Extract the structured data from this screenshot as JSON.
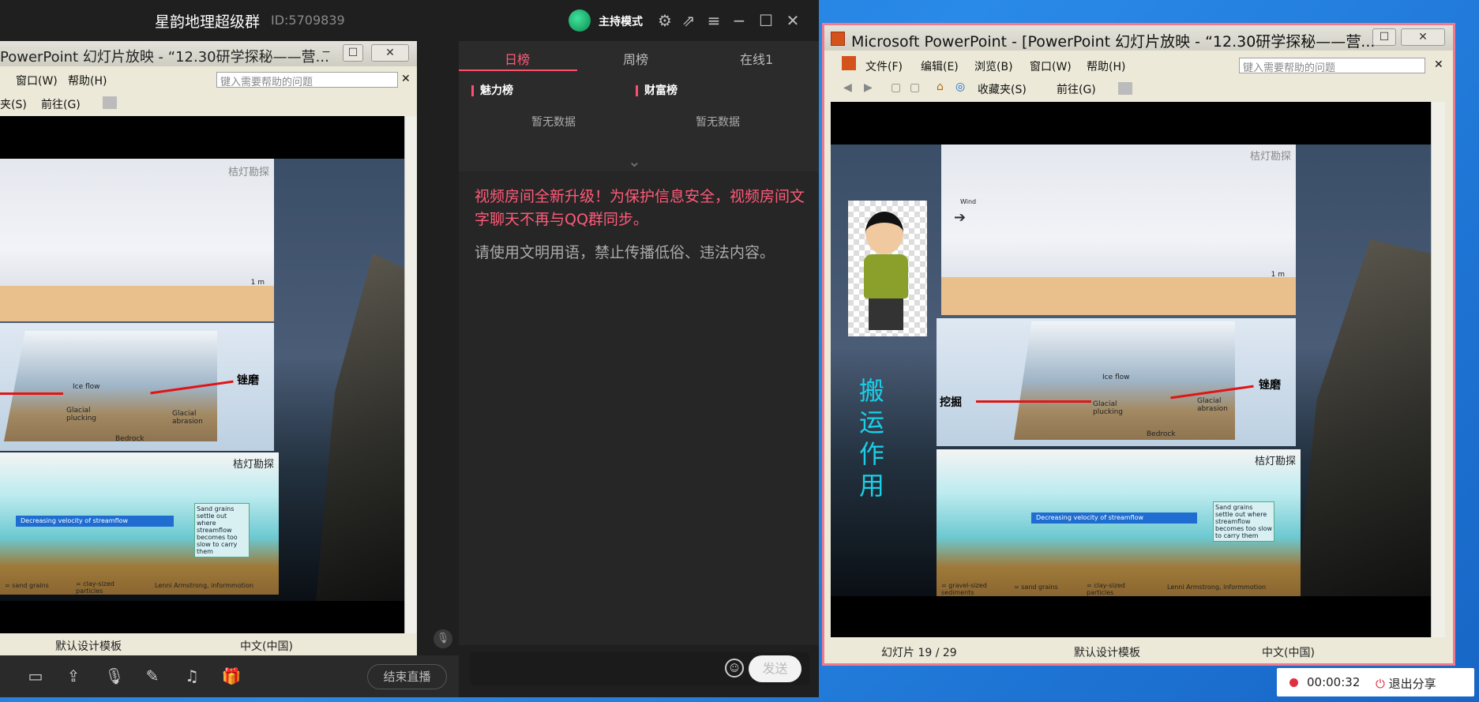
{
  "qq": {
    "group_name": "星韵地理超级群",
    "group_id": "ID:5709839",
    "host_mode": "主持模式",
    "tabs": [
      "日榜",
      "周榜",
      "在线1"
    ],
    "charm_rank": "魅力榜",
    "wealth_rank": "财富榜",
    "no_data": "暂无数据",
    "notice": "视频房间全新升级！为保护信息安全，视频房间文字聊天不再与QQ群同步。",
    "rules": "请使用文明用语，禁止传播低俗、违法内容。",
    "send": "发送",
    "end_live": "结束直播"
  },
  "left_ppt": {
    "title": "PowerPoint 幻灯片放映 - “12.30研学探秘——营...",
    "menu": [
      "窗口(W)",
      "帮助(H)"
    ],
    "help_placeholder": "键入需要帮助的问题",
    "toolbar_fav": "夹(S)",
    "toolbar_go": "前往(G)",
    "status_template": "默认设计模板",
    "status_lang": "中文(中国)"
  },
  "right_ppt": {
    "title": "Microsoft PowerPoint - [PowerPoint 幻灯片放映 - “12.30研学探秘——营...",
    "menu": [
      "文件(F)",
      "编辑(E)",
      "浏览(B)",
      "窗口(W)",
      "帮助(H)"
    ],
    "help_placeholder": "键入需要帮助的问题",
    "toolbar_fav": "收藏夹(S)",
    "toolbar_go": "前往(G)",
    "status_slide": "幻灯片 19 / 29",
    "status_template": "默认设计模板",
    "status_lang": "中文(中国)"
  },
  "slide": {
    "watermark": "桔灯勘探",
    "wind": "Wind",
    "ice_flow": "Ice flow",
    "glacial_abrasion": "Glacial abrasion",
    "glacial_plucking": "Glacial plucking",
    "bedrock": "Bedrock",
    "abrasion_cn": "锉磨",
    "plucking_cn": "挖掘",
    "velocity": "Decreasing velocity of streamflow",
    "sand_note": "Sand grains settle out where streamflow becomes too slow to carry them",
    "legend_gravel": "= gravel-sized sediments",
    "legend_sand": "= sand grains",
    "legend_clay": "= clay-sized particles",
    "credit": "Lenni Armstrong, informmotion",
    "scale": "1 m",
    "transport": [
      "搬",
      "运",
      "作",
      "用"
    ]
  },
  "sharing": {
    "time": "00:00:32",
    "exit": "退出分享"
  },
  "colors": {
    "accent": "#ff4f6e",
    "notice": "#ff5a78",
    "cyan_text": "#19d0e8"
  }
}
